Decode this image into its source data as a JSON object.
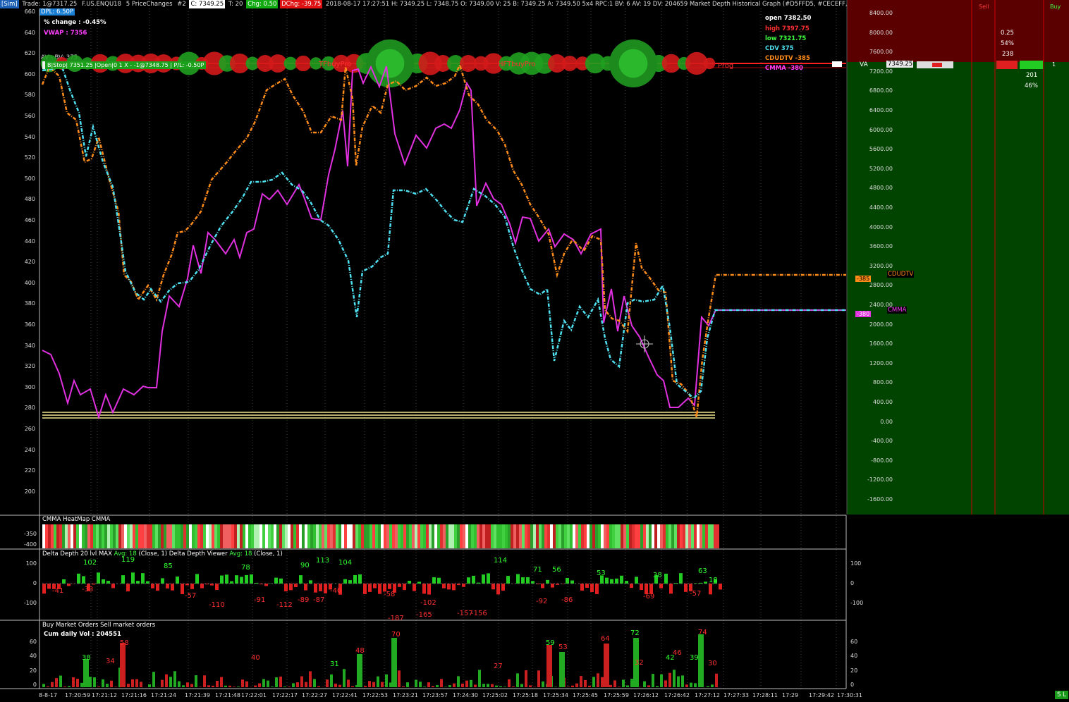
{
  "header": {
    "sim": "[Sim]",
    "trade": "Trade: 1@7317.25",
    "symbol": "F.US.ENQU18",
    "bar_type": "5 PriceChanges",
    "bar_num": "#2",
    "close": "C: 7349.25",
    "ticks": "T: 20",
    "chg": "Chg: 0.50",
    "dchg": "DChg: -39.75",
    "rest": "2018-08-17  17:27:51  H: 7349.25  L: 7348.75  O: 7349.00  V: 25  B: 7349.25  A: 7349.50  5x4 RPC:1  BV: 6  AV: 19  DV: 204659  Market Depth Historical Graph   (#D5FFD5, #CECEFF, 0, 0, 0, Yes, Yes, #00",
    "dpl": "DPL: 6.50P",
    "pct_change": "% change : -0.45%",
    "vwap": "VWAP : 7356",
    "av_bv": "AV - BV: 375",
    "position": "B|Stop| 7351.25 |Open|0 1   X - -1@7348.75 | P/L: -0.50P",
    "tfbuy": "TFbuyPro",
    "hftbuy": "HFTbuyPro",
    "prog": "Prog",
    "va": "VA",
    "va_price": "7349.25"
  },
  "legend": {
    "open": "open 7382.50",
    "high": "high 7397.75",
    "low": "low 7321.75",
    "cdv": "CDV 375",
    "cdudtv": "CDUDTV -385",
    "cmma": "CMMA -380"
  },
  "colors": {
    "orange": "#ff8c1a",
    "cyan": "#4ee0f0",
    "magenta": "#e030e0",
    "green": "#22cc22",
    "red": "#e02020"
  },
  "main_axis": {
    "left": [
      "660",
      "640",
      "620",
      "600",
      "580",
      "560",
      "540",
      "520",
      "500",
      "480",
      "460",
      "440",
      "420",
      "400",
      "380",
      "360",
      "340",
      "320",
      "300",
      "280",
      "260",
      "240",
      "220",
      "200"
    ],
    "right": [
      "8400.00",
      "8000.00",
      "7600.00",
      "7200.00",
      "6800.00",
      "6400.00",
      "6000.00",
      "5600.00",
      "5200.00",
      "4800.00",
      "4400.00",
      "4000.00",
      "3600.00",
      "3200.00",
      "2800.00",
      "2400.00",
      "2000.00",
      "1600.00",
      "1200.00",
      "800.00",
      "400.00",
      "0.00",
      "-400.00",
      "-800.00",
      "-1200.00",
      "-1600.00"
    ]
  },
  "markers": {
    "cdudtv_val": "-385",
    "cdudtv_name": "CDUDTV",
    "cmma_val": "-380",
    "cmma_name": "CMMA"
  },
  "depth_ladder": {
    "sell": "Sell",
    "buy": "Buy",
    "v1": "0.25",
    "v2": "54%",
    "v3": "238",
    "v4": "201",
    "v5": "46%",
    "one": "1"
  },
  "heatmap": {
    "title": "CMMA HeatMap  CMMA",
    "ticks": [
      "-350",
      "-400"
    ]
  },
  "delta": {
    "title1": "Delta Depth 20 lvl MAX",
    "avg1": "Avg: 18",
    "close1": "(Close, 1)",
    "title2": "Delta Depth Viewer",
    "avg2": "Avg: 18",
    "close2": "(Close, 1)",
    "left_ticks": [
      "100",
      "0",
      "-100"
    ],
    "right_ticks": [
      "100",
      "0",
      "-100"
    ],
    "labels": [
      "102",
      "119",
      "85",
      "78",
      "90",
      "113",
      "104",
      "114",
      "71",
      "56",
      "53",
      "38",
      "63",
      "-41",
      "-33",
      "-57",
      "-110",
      "-91",
      "-112",
      "-89",
      "-87",
      "-40",
      "-58",
      "-187",
      "-102",
      "-165",
      "-157",
      "-156",
      "-92",
      "-86",
      "-69",
      "-57",
      "18"
    ]
  },
  "volume": {
    "title": "Buy Market Orders  Sell market orders",
    "cum": "Cum daily Vol : 204551",
    "left_ticks": [
      "60",
      "40",
      "20",
      "0"
    ],
    "right_ticks": [
      "60",
      "40",
      "20",
      "0"
    ],
    "labels": [
      "58",
      "38",
      "70",
      "48",
      "59",
      "53",
      "64",
      "72",
      "74",
      "46",
      "42",
      "34",
      "40",
      "31",
      "27",
      "32",
      "39",
      "30"
    ]
  },
  "time_axis": [
    "8-8-17",
    "17:20:59",
    "17:21:12",
    "17:21:16",
    "17:21:24",
    "17:21:39",
    "17:21:48",
    "17:22:01",
    "17:22:17",
    "17:22:27",
    "17:22:41",
    "17:22:53",
    "17:23:21",
    "17:23:57",
    "17:24:30",
    "17:25:02",
    "17:25:18",
    "17:25:34",
    "17:25:45",
    "17:25:59",
    "17:26:12",
    "17:26:42",
    "17:27:12",
    "17:27:33",
    "17:28:11",
    "17:29",
    "17:29:42",
    "17:30:31"
  ],
  "status": {
    "sl": "S L"
  }
}
